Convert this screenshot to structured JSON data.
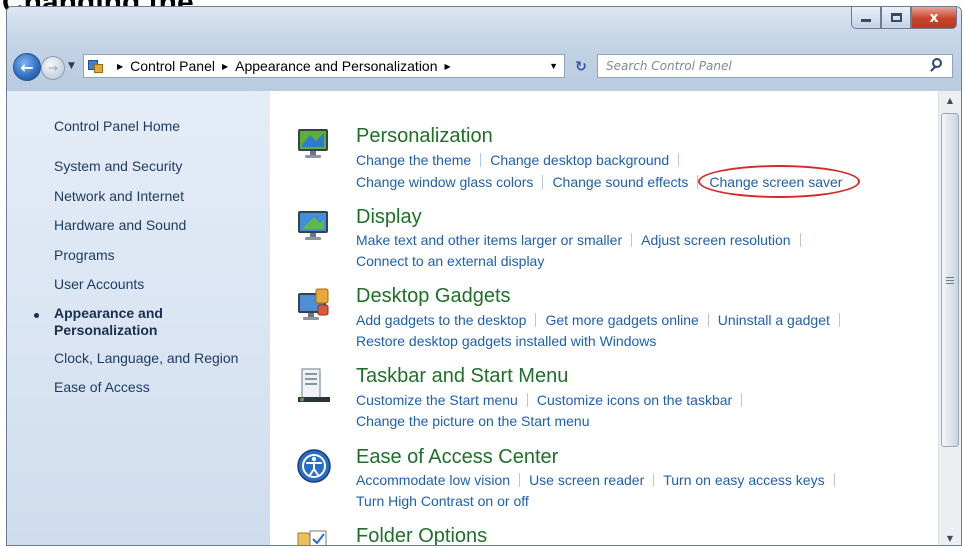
{
  "top_band_text": "Changing the",
  "window": {
    "caption": {
      "minimize": "",
      "maximize": "",
      "close": "x"
    }
  },
  "address": {
    "crumbs": [
      "Control Panel",
      "Appearance and Personalization"
    ],
    "search_placeholder": "Search Control Panel"
  },
  "sidebar": {
    "home": "Control Panel Home",
    "items": [
      {
        "label": "System and Security"
      },
      {
        "label": "Network and Internet"
      },
      {
        "label": "Hardware and Sound"
      },
      {
        "label": "Programs"
      },
      {
        "label": "User Accounts"
      },
      {
        "label": "Appearance and",
        "label2": "Personalization",
        "active": true
      },
      {
        "label": "Clock, Language, and Region"
      },
      {
        "label": "Ease of Access"
      }
    ]
  },
  "categories": [
    {
      "title": "Personalization",
      "icon": "personalization-icon",
      "links_row1": [
        "Change the theme",
        "Change desktop background"
      ],
      "links_row2": [
        "Change window glass colors",
        "Change sound effects",
        "Change screen saver"
      ]
    },
    {
      "title": "Display",
      "icon": "display-icon",
      "links_row1": [
        "Make text and other items larger or smaller",
        "Adjust screen resolution"
      ],
      "links_row2": [
        "Connect to an external display"
      ]
    },
    {
      "title": "Desktop Gadgets",
      "icon": "gadgets-icon",
      "links_row1": [
        "Add gadgets to the desktop",
        "Get more gadgets online",
        "Uninstall a gadget"
      ],
      "links_row2": [
        "Restore desktop gadgets installed with Windows"
      ]
    },
    {
      "title": "Taskbar and Start Menu",
      "icon": "taskbar-icon",
      "links_row1": [
        "Customize the Start menu",
        "Customize icons on the taskbar"
      ],
      "links_row2": [
        "Change the picture on the Start menu"
      ]
    },
    {
      "title": "Ease of Access Center",
      "icon": "ease-of-access-icon",
      "links_row1": [
        "Accommodate low vision",
        "Use screen reader",
        "Turn on easy access keys"
      ],
      "links_row2": [
        "Turn High Contrast on or off"
      ]
    },
    {
      "title": "Folder Options",
      "icon": "folder-options-icon"
    }
  ],
  "colors": {
    "category_title": "#1f6f2a",
    "link": "#1d5fb3",
    "highlight_circle": "#d7282b"
  }
}
